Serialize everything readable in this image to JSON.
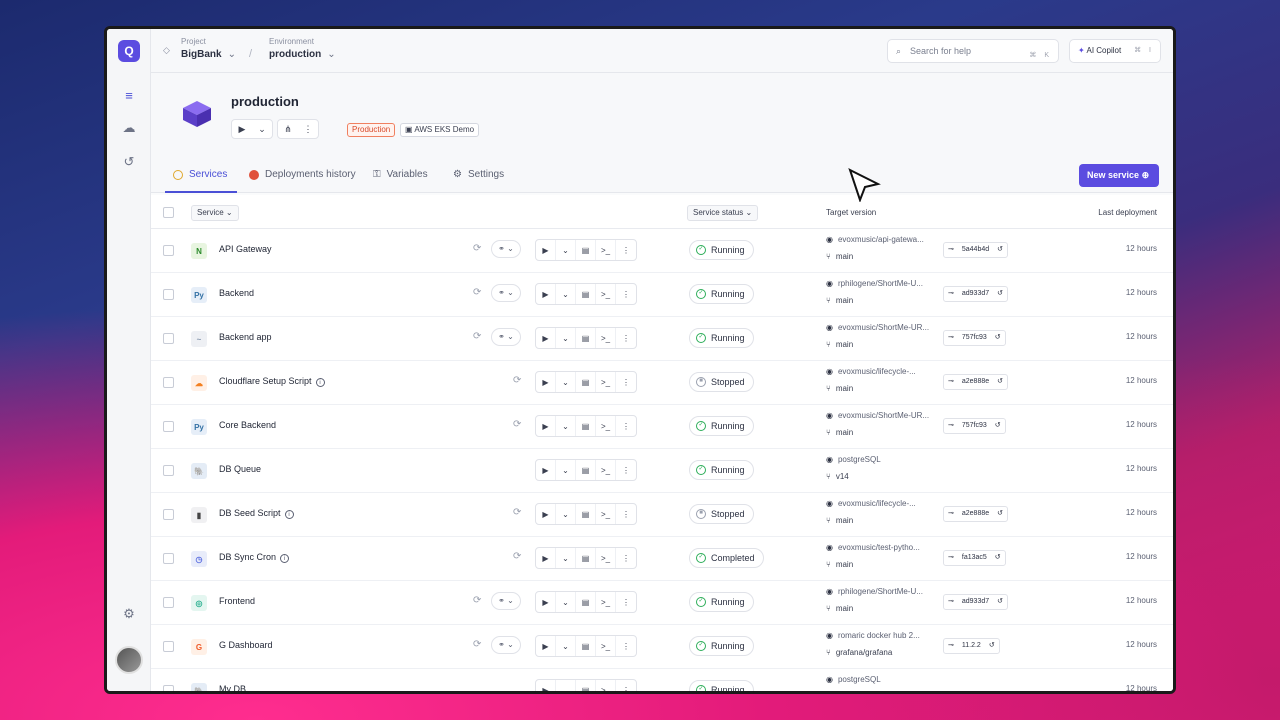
{
  "topbar": {
    "project_label": "Project",
    "project_value": "BigBank",
    "environment_label": "Environment",
    "environment_value": "production",
    "search_placeholder": "Search for help",
    "search_shortcut": "⌘ K",
    "copilot_label": "AI Copilot",
    "copilot_shortcut": "⌘ I"
  },
  "environment": {
    "name": "production",
    "tags": [
      "Production",
      "AWS EKS Demo"
    ]
  },
  "tabs": [
    {
      "label": "Services",
      "active": true
    },
    {
      "label": "Deployments history",
      "active": false
    },
    {
      "label": "Variables",
      "active": false
    },
    {
      "label": "Settings",
      "active": false
    }
  ],
  "new_service_label": "New service",
  "table": {
    "headers": {
      "service": "Service",
      "status": "Service status",
      "target": "Target version",
      "last": "Last deployment"
    },
    "rows": [
      {
        "name": "API Gateway",
        "status": "Running",
        "repo": "evoxmusic/api-gatewa...",
        "branch": "main",
        "commit": "5a44b4d",
        "last": "12 hours"
      },
      {
        "name": "Backend",
        "status": "Running",
        "repo": "rphilogene/ShortMe-U...",
        "branch": "main",
        "commit": "ad933d7",
        "last": "12 hours"
      },
      {
        "name": "Backend app",
        "status": "Running",
        "repo": "evoxmusic/ShortMe-UR...",
        "branch": "main",
        "commit": "757fc93",
        "last": "12 hours"
      },
      {
        "name": "Cloudflare Setup Script",
        "status": "Stopped",
        "repo": "evoxmusic/lifecycle-...",
        "branch": "main",
        "commit": "a2e888e",
        "last": "12 hours"
      },
      {
        "name": "Core Backend",
        "status": "Running",
        "repo": "evoxmusic/ShortMe-UR...",
        "branch": "main",
        "commit": "757fc93",
        "last": "12 hours"
      },
      {
        "name": "DB Queue",
        "status": "Running",
        "repo": "postgreSQL",
        "branch": "v14",
        "commit": "",
        "last": "12 hours"
      },
      {
        "name": "DB Seed Script",
        "status": "Stopped",
        "repo": "evoxmusic/lifecycle-...",
        "branch": "main",
        "commit": "a2e888e",
        "last": "12 hours"
      },
      {
        "name": "DB Sync Cron",
        "status": "Completed",
        "repo": "evoxmusic/test-pytho...",
        "branch": "main",
        "commit": "fa13ac5",
        "last": "12 hours"
      },
      {
        "name": "Frontend",
        "status": "Running",
        "repo": "rphilogene/ShortMe-U...",
        "branch": "main",
        "commit": "ad933d7",
        "last": "12 hours"
      },
      {
        "name": "G Dashboard",
        "status": "Running",
        "repo": "romaric docker hub 2...",
        "branch": "grafana/grafana",
        "commit": "11.2.2",
        "last": "12 hours"
      },
      {
        "name": "My DB",
        "status": "Running",
        "repo": "postgreSQL",
        "branch": "",
        "commit": "",
        "last": "12 hours"
      }
    ]
  },
  "colors": {
    "accent": "#5b4ce0",
    "running": "#2eae5a",
    "stopped": "#9aa0ae",
    "production_tag": "#d84a2a"
  }
}
